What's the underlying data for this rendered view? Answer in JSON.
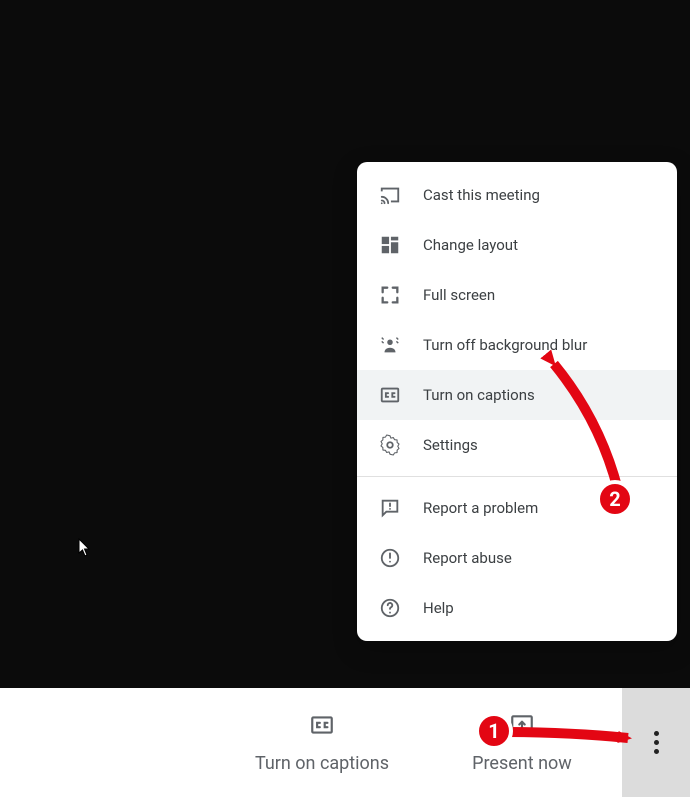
{
  "bottom": {
    "captions_label": "Turn on captions",
    "present_label": "Present now"
  },
  "menu": {
    "items": [
      {
        "label": "Cast this meeting"
      },
      {
        "label": "Change layout"
      },
      {
        "label": "Full screen"
      },
      {
        "label": "Turn off background blur"
      },
      {
        "label": "Turn on captions"
      },
      {
        "label": "Settings"
      },
      {
        "label": "Report a problem"
      },
      {
        "label": "Report abuse"
      },
      {
        "label": "Help"
      }
    ]
  },
  "annotations": {
    "step1": "1",
    "step2": "2"
  }
}
